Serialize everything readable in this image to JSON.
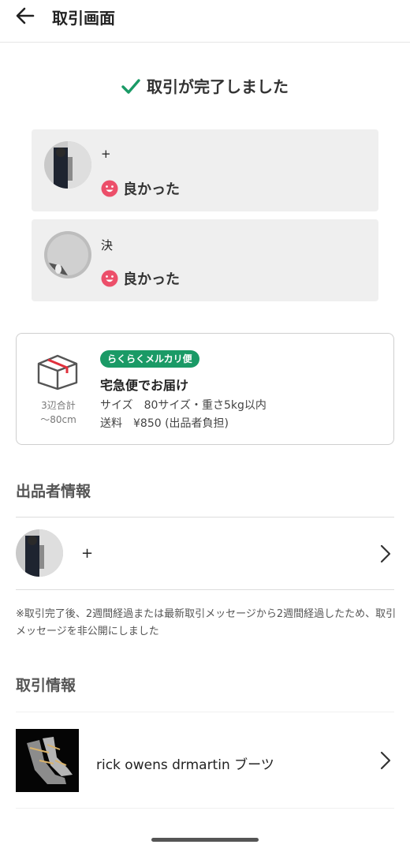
{
  "header": {
    "title": "取引画面"
  },
  "complete": {
    "label": "取引が完了しました"
  },
  "reviews": [
    {
      "name": "+",
      "rating": "良かった"
    },
    {
      "name": "決",
      "rating": "良かった"
    }
  ],
  "shipping": {
    "badge": "らくらくメルカリ便",
    "method": "宅急便でお届け",
    "size_note_line1": "3辺合計",
    "size_note_line2": "〜80cm",
    "size": "サイズ　80サイズ・重さ5kg以内",
    "fee": "送料　¥850 (出品者負担)"
  },
  "seller_section": {
    "title": "出品者情報",
    "name": "+"
  },
  "notice": "※取引完了後、2週間経過または最新取引メッセージから2週間経過したため、取引メッセージを非公開にしました",
  "trade_section": {
    "title": "取引情報",
    "item_name": "rick owens drmartin ブーツ"
  },
  "colors": {
    "accent_green": "#1a9a66",
    "smile_pink": "#ec4f6a",
    "badge_green": "#1a9a66"
  }
}
